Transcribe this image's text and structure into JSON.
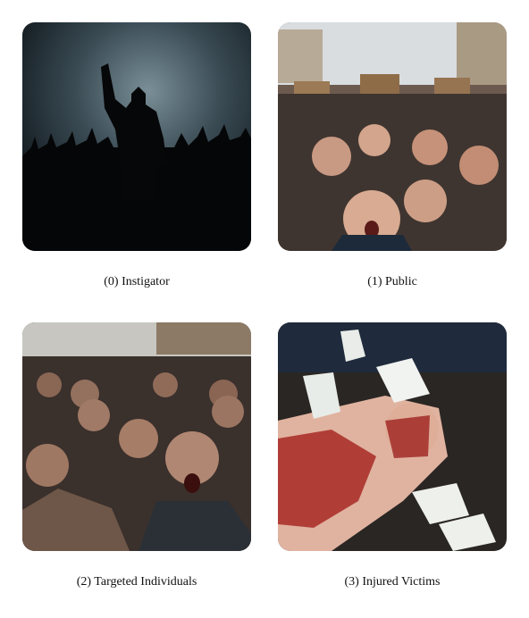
{
  "panels": [
    {
      "caption": "(0) Instigator",
      "image": "silhouette-of-man-raising-fist-above-crowd"
    },
    {
      "caption": "(1) Public",
      "image": "angry-shouting-protest-crowd-in-street"
    },
    {
      "caption": "(2) Targeted Individuals",
      "image": "enraged-bloodied-mob-charging"
    },
    {
      "caption": "(3) Injured Victims",
      "image": "bleeding-victim-on-ground-with-gloved-hands"
    }
  ]
}
